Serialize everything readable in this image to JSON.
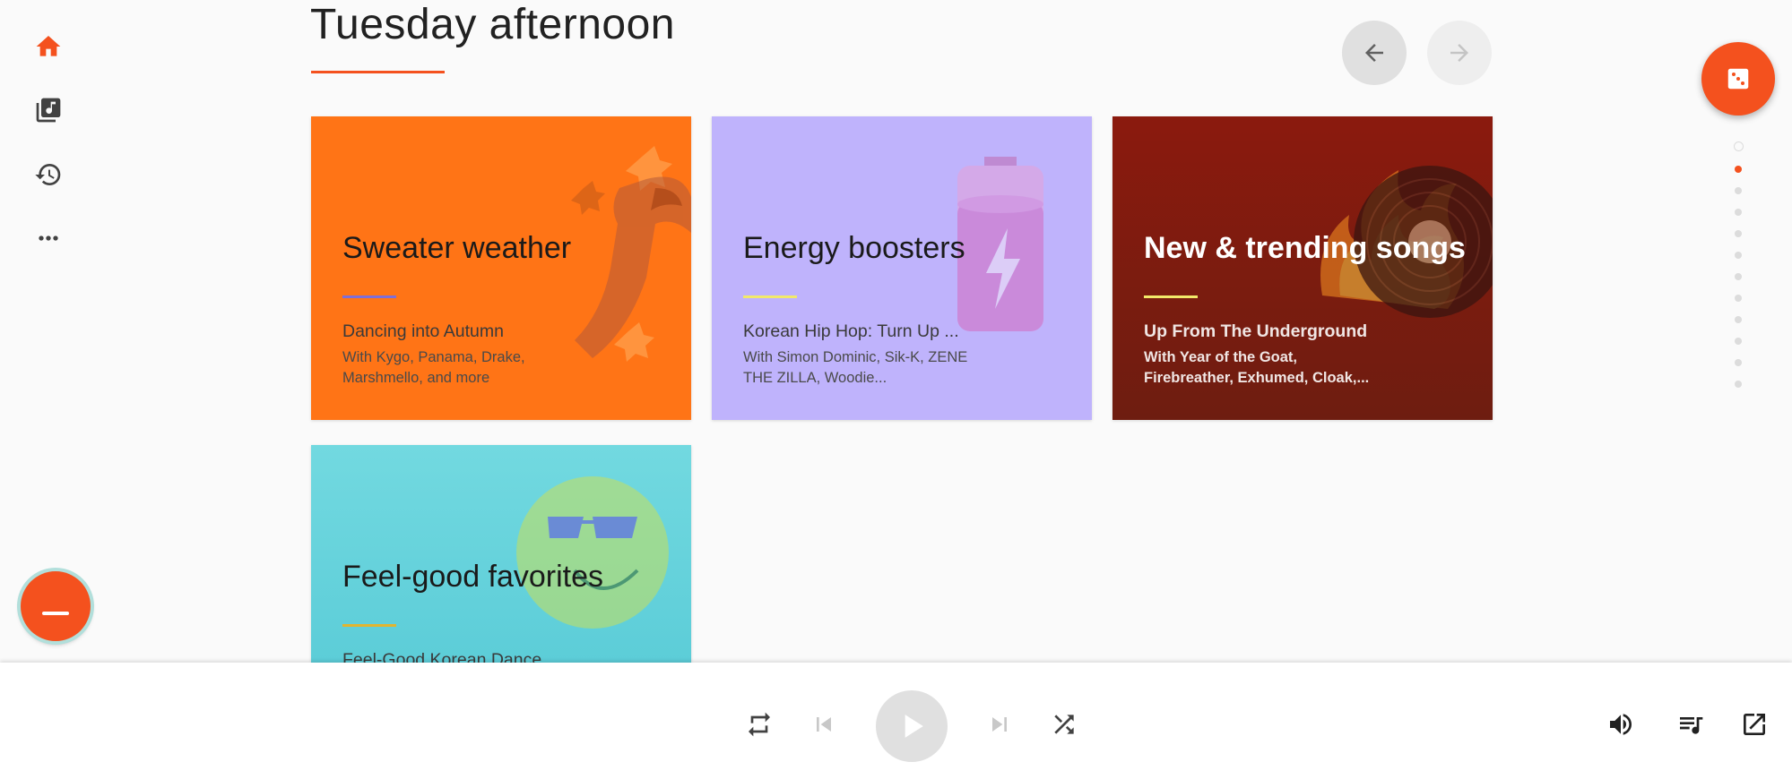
{
  "section": {
    "title": "Tuesday afternoon"
  },
  "colors": {
    "accent": "#f4511e",
    "nav_active": "#f4511e",
    "nav_inactive": "#424242"
  },
  "nav": {
    "items": [
      {
        "name": "home",
        "icon": "home-icon",
        "active": true
      },
      {
        "name": "library",
        "icon": "library-music-icon",
        "active": false
      },
      {
        "name": "history",
        "icon": "history-icon",
        "active": false
      },
      {
        "name": "more",
        "icon": "more-horiz-icon",
        "active": false
      }
    ],
    "minimize_icon": "minimize-icon"
  },
  "controls": {
    "prev_icon": "arrow-back-icon",
    "next_icon": "arrow-forward-icon",
    "shuffle_fab_icon": "dice-icon"
  },
  "pager": {
    "count": 12,
    "active_index": 1
  },
  "cards": [
    {
      "title": "Sweater weather",
      "subtitle": "Dancing into Autumn",
      "description": "With Kygo, Panama, Drake, Marshmello, and more",
      "background": "#ff7416",
      "rule_color": "#7e6fd8"
    },
    {
      "title": "Energy boosters",
      "subtitle": "Korean Hip Hop: Turn Up ...",
      "description": "With Simon Dominic, Sik-K, ZENE THE ZILLA, Woodie...",
      "background": "#bfb3fc",
      "rule_color": "#f2e96a"
    },
    {
      "title": "New & trending songs",
      "subtitle": "Up From The Underground",
      "description": "With Year of the Goat, Firebreather, Exhumed, Cloak,...",
      "background": "#7a1c0f",
      "rule_color": "#f2e96a"
    },
    {
      "title": "Feel-good favorites",
      "subtitle": "Feel-Good Korean Dance ...",
      "description": "",
      "background": "#66d4dc",
      "rule_color": "#e0b530"
    }
  ],
  "player": {
    "repeat_icon": "repeat-icon",
    "skip_previous_icon": "skip-previous-icon",
    "play_icon": "play-icon",
    "skip_next_icon": "skip-next-icon",
    "shuffle_icon": "shuffle-icon",
    "volume_icon": "volume-icon",
    "queue_icon": "queue-music-icon",
    "popout_icon": "open-in-new-icon"
  }
}
